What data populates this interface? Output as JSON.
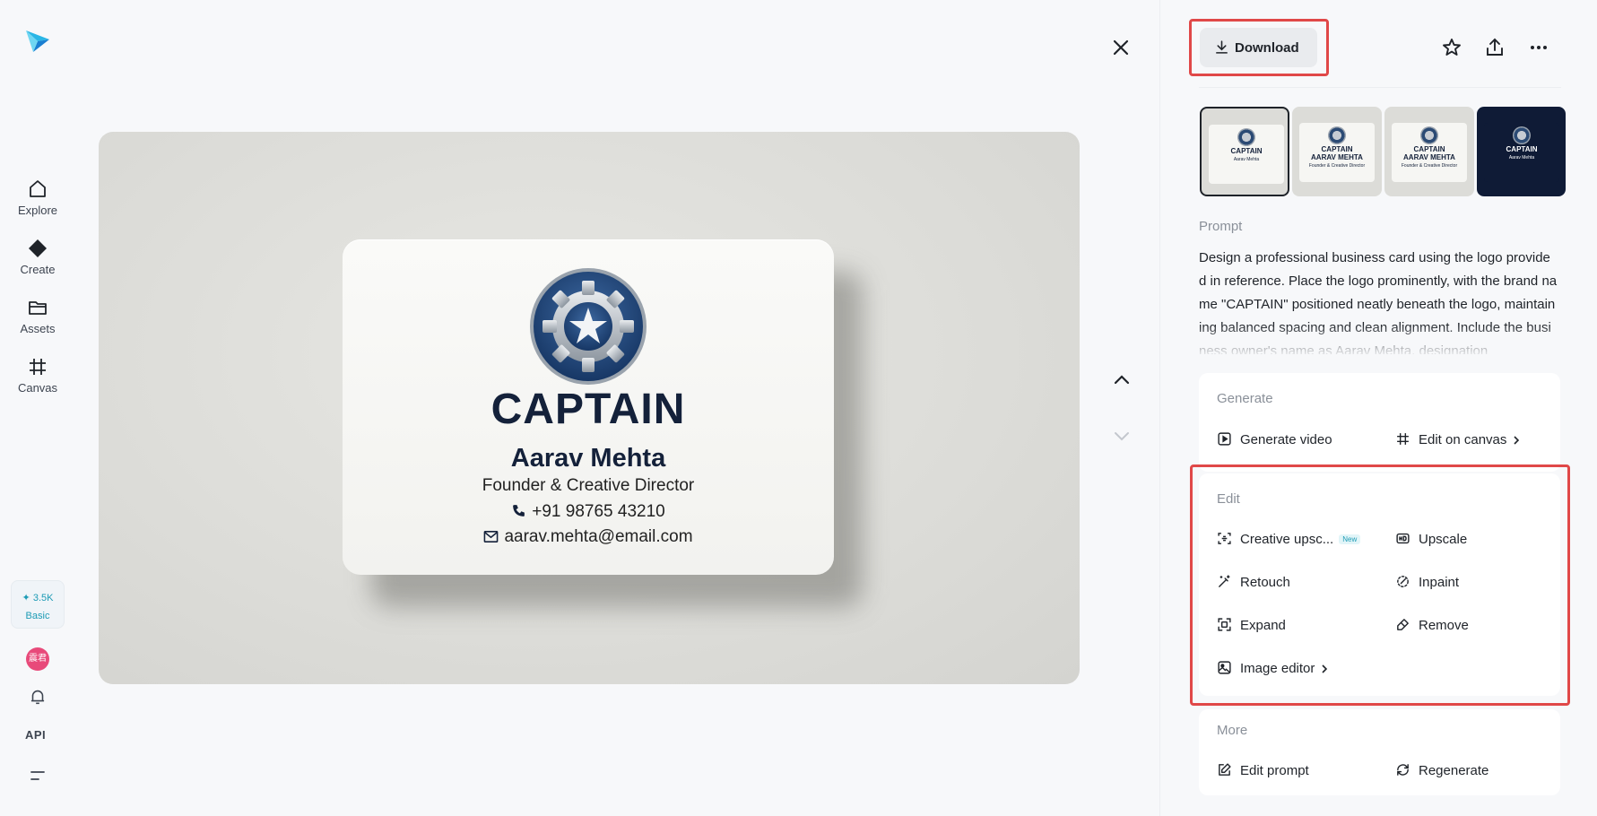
{
  "nav": {
    "explore": "Explore",
    "create": "Create",
    "assets": "Assets",
    "canvas": "Canvas",
    "credits_amount": "✦ 3.5K",
    "credits_plan": "Basic",
    "avatar_text": "震君",
    "api": "API"
  },
  "preview_card": {
    "brand": "CAPTAIN",
    "name": "Aarav Mehta",
    "title": "Founder & Creative Director",
    "phone": "+91 98765 43210",
    "email": "aarav.mehta@email.com"
  },
  "thumbnails": [
    {
      "brand": "CAPTAIN",
      "sub": "Aarav Mehta",
      "selected": true
    },
    {
      "brand": "CAPTAIN",
      "name": "AARAV MEHTA",
      "sub": "Founder & Creative Director",
      "selected": false
    },
    {
      "brand": "CAPTAIN",
      "name": "AARAV MEHTA",
      "sub": "Founder & Creative Director",
      "selected": false
    },
    {
      "brand": "CAPTAIN",
      "sub": "Aarav Mehta",
      "selected": false,
      "dark": true
    }
  ],
  "toolbar": {
    "download_label": "Download"
  },
  "prompt": {
    "title": "Prompt",
    "text": "Design a professional business card using the logo provided in reference. Place the logo prominently, with the brand name \"CAPTAIN\" positioned neatly beneath the logo, maintaining balanced spacing and clean alignment. Include the business owner's name as Aarav Mehta, designation"
  },
  "generate": {
    "title": "Generate",
    "video": "Generate video",
    "canvas": "Edit on canvas"
  },
  "edit": {
    "title": "Edit",
    "creative_upscale": "Creative upsc...",
    "new_badge": "New",
    "upscale": "Upscale",
    "retouch": "Retouch",
    "inpaint": "Inpaint",
    "expand": "Expand",
    "remove": "Remove",
    "image_editor": "Image editor"
  },
  "more": {
    "title": "More",
    "edit_prompt": "Edit prompt",
    "regenerate": "Regenerate"
  },
  "colors": {
    "highlight": "#e04848",
    "accent": "#1d9bb5",
    "card_navy": "#14213a"
  }
}
